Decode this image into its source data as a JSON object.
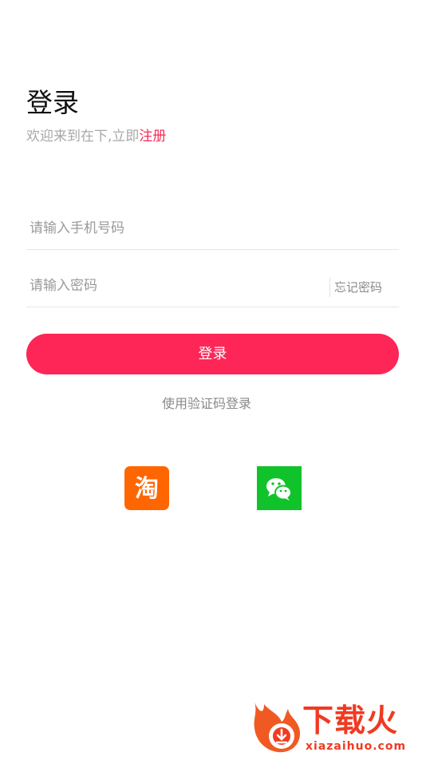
{
  "header": {
    "title": "登录",
    "welcome_text": "欢迎来到在下,立即",
    "register_link": "注册"
  },
  "form": {
    "phone_placeholder": "请输入手机号码",
    "password_placeholder": "请输入密码",
    "forgot_password": "忘记密码",
    "login_button": "登录"
  },
  "alt_login": {
    "sms_login": "使用验证码登录"
  },
  "social": [
    {
      "name": "taobao",
      "glyph": "淘",
      "icon": "taobao-icon",
      "color": "#ff6600"
    },
    {
      "name": "wechat",
      "icon": "wechat-icon",
      "color": "#11c32b"
    }
  ],
  "watermark": {
    "brand": "下载火",
    "url": "xiazaihuo.com"
  },
  "colors": {
    "accent": "#fd2657",
    "register_link": "#f52a57",
    "watermark": "#f03a22"
  }
}
